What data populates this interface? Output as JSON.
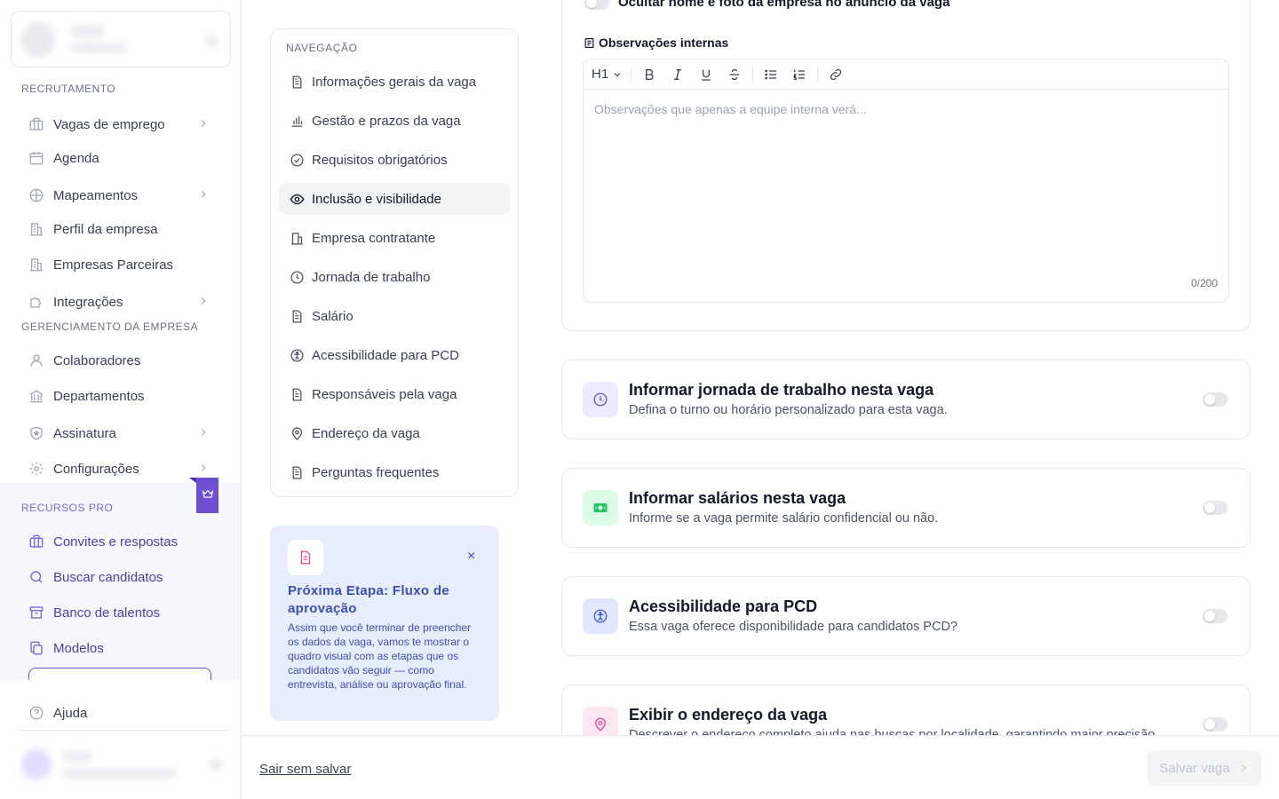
{
  "sidebar": {
    "sections": {
      "recruitment": "RECRUTAMENTO",
      "company": "GERENCIAMENTO DA EMPRESA",
      "pro": "RECURSOS PRO"
    },
    "items": [
      {
        "label": "Vagas de emprego",
        "icon": "briefcase-icon"
      },
      {
        "label": "Agenda",
        "icon": "calendar-icon"
      },
      {
        "label": "Mapeamentos",
        "icon": "map-icon"
      },
      {
        "label": "Perfil da empresa",
        "icon": "building-icon"
      },
      {
        "label": "Empresas Parceiras",
        "icon": "building-icon"
      },
      {
        "label": "Integrações",
        "icon": "puzzle-icon"
      },
      {
        "label": "Colaboradores",
        "icon": "user-icon"
      },
      {
        "label": "Departamentos",
        "icon": "bank-icon"
      },
      {
        "label": "Assinatura",
        "icon": "shield-icon"
      },
      {
        "label": "Configurações",
        "icon": "gear-icon"
      },
      {
        "label": "Convites e respostas",
        "icon": "briefcase-icon"
      },
      {
        "label": "Buscar candidatos",
        "icon": "search-icon"
      },
      {
        "label": "Banco de talentos",
        "icon": "archive-icon"
      },
      {
        "label": "Modelos",
        "icon": "copy-icon"
      },
      {
        "label": "Ajuda",
        "icon": "help-icon"
      }
    ]
  },
  "nav": {
    "heading": "NAVEGAÇÃO",
    "items": [
      {
        "label": "Informações gerais da vaga",
        "icon": "document-icon"
      },
      {
        "label": "Gestão e prazos da vaga",
        "icon": "bar-chart-icon"
      },
      {
        "label": "Requisitos obrigatórios",
        "icon": "check-circle-icon"
      },
      {
        "label": "Inclusão e visibilidade",
        "icon": "eye-icon"
      },
      {
        "label": "Empresa contratante",
        "icon": "building-icon"
      },
      {
        "label": "Jornada de trabalho",
        "icon": "clock-icon"
      },
      {
        "label": "Salário",
        "icon": "document-icon"
      },
      {
        "label": "Acessibilidade para PCD",
        "icon": "accessibility-icon"
      },
      {
        "label": "Responsáveis pela vaga",
        "icon": "document-icon"
      },
      {
        "label": "Endereço da vaga",
        "icon": "map-pin-icon"
      },
      {
        "label": "Perguntas frequentes",
        "icon": "document-icon"
      }
    ],
    "active_index": 3
  },
  "tip": {
    "title": "Próxima Etapa: Fluxo de aprovação",
    "body": "Assim que você terminar de preencher os dados da vaga, vamos te mostrar o quadro visual com as etapas que os candidatos vão seguir — como entrevista, análise ou aprovação final.",
    "close": "×"
  },
  "main": {
    "hide_company_label": "Ocultar nome e foto da empresa no anúncio da vaga",
    "internal_notes_label": "Observações internas",
    "editor": {
      "heading_selector": "H1",
      "placeholder": "Observações que apenas a equipe interna verá...",
      "counter": "0/200"
    },
    "options": [
      {
        "title": "Informar jornada de trabalho nesta vaga",
        "description": "Defina o turno ou horário personalizado para esta vaga.",
        "icon": "clock-icon",
        "icon_bg": "#ede9fe",
        "icon_color": "#6d5bd0",
        "enabled": false
      },
      {
        "title": "Informar salários nesta vaga",
        "description": "Informe se a vaga permite salário confidencial ou não.",
        "icon": "money-icon",
        "icon_bg": "#dcfce7",
        "icon_color": "#22c55e",
        "enabled": false
      },
      {
        "title": "Acessibilidade para PCD",
        "description": "Essa vaga oferece disponibilidade para candidatos PCD?",
        "icon": "accessibility-icon",
        "icon_bg": "#e0e7ff",
        "icon_color": "#3b5bdb",
        "enabled": false
      },
      {
        "title": "Exibir o endereço da vaga",
        "description": "Descrever o endereço completo ajuda nas buscas por localidade, garantindo maior precisão.",
        "icon": "map-pin-icon",
        "icon_bg": "#fce7f3",
        "icon_color": "#ec4899",
        "enabled": false
      }
    ]
  },
  "footer": {
    "exit_label": "Sair sem salvar",
    "save_label": "Salvar vaga"
  }
}
